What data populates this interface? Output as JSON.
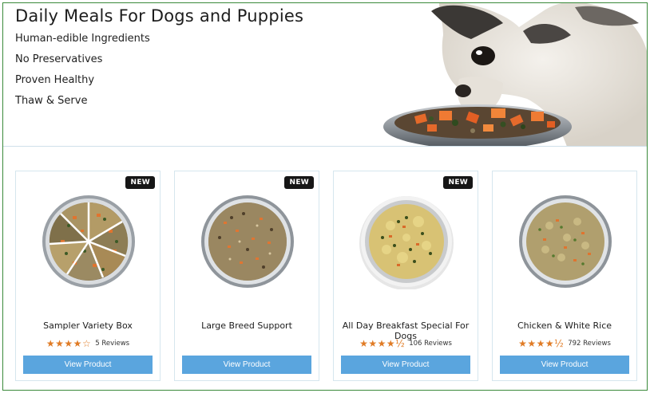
{
  "hero": {
    "title": "Daily Meals For Dogs and Puppies",
    "features": [
      "Human-edible Ingredients",
      "No Preservatives",
      "Proven Healthy",
      "Thaw & Serve"
    ]
  },
  "products": [
    {
      "name": "Sampler Variety Box",
      "badge": "NEW",
      "rating": 4,
      "stars": "★★★★☆",
      "reviews": "5 Reviews",
      "button": "View Product"
    },
    {
      "name": "Large Breed Support",
      "badge": "NEW",
      "rating": null,
      "stars": "",
      "reviews": "",
      "button": "View Product"
    },
    {
      "name": "All Day Breakfast Special For Dogs",
      "badge": "NEW",
      "rating": 4.5,
      "stars": "★★★★½",
      "reviews": "106 Reviews",
      "button": "View Product"
    },
    {
      "name": "Chicken & White Rice",
      "badge": "",
      "rating": 4.5,
      "stars": "★★★★½",
      "reviews": "792 Reviews",
      "button": "View Product"
    }
  ],
  "colors": {
    "button": "#5aa5de",
    "star": "#e07b25",
    "badge": "#161616",
    "frame": "#3a8a3a"
  }
}
